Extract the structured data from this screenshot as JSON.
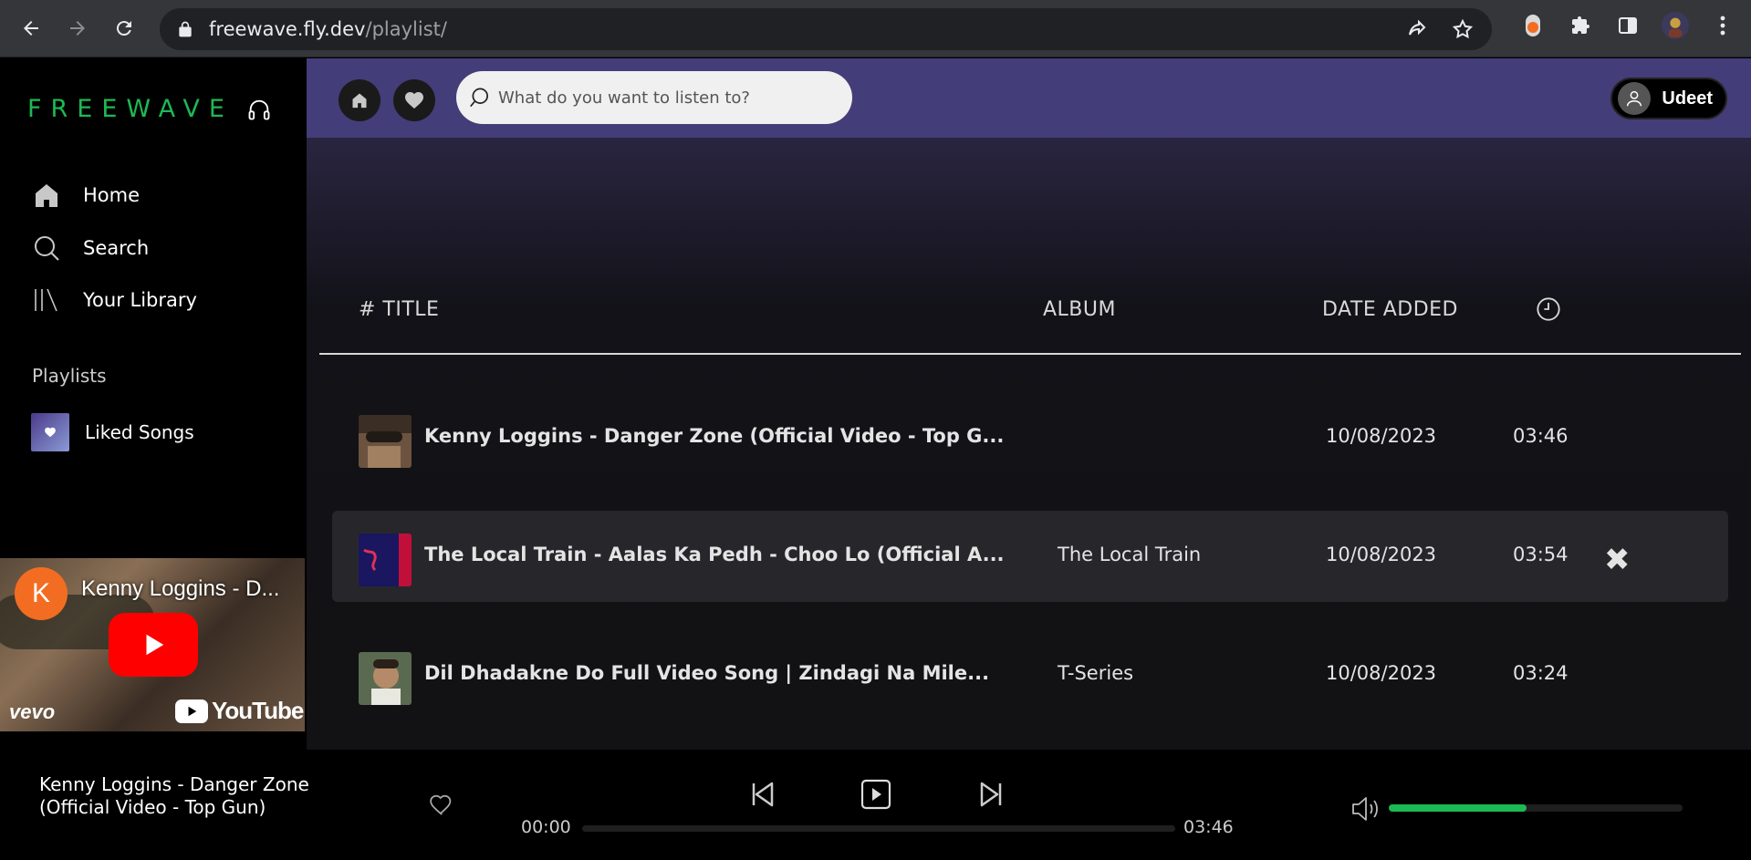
{
  "browser": {
    "url_host": "freewave.fly.dev",
    "url_path": "/playlist/"
  },
  "sidebar": {
    "logo": "FREEWAVE",
    "nav": [
      {
        "label": "Home",
        "icon": "home-icon"
      },
      {
        "label": "Search",
        "icon": "search-icon"
      },
      {
        "label": "Your Library",
        "icon": "library-icon"
      }
    ],
    "playlists_label": "Playlists",
    "liked_songs": "Liked Songs"
  },
  "video": {
    "channel_initial": "K",
    "title": "Kenny Loggins - D...",
    "vevo": "vevo",
    "youtube": "YouTube"
  },
  "header": {
    "search_placeholder": "What do you want to listen to?",
    "user_name": "Udeet"
  },
  "table": {
    "col_title": "# TITLE",
    "col_album": "ALBUM",
    "col_date": "DATE ADDED",
    "rows": [
      {
        "title": "Kenny Loggins - Danger Zone (Official Video - Top G...",
        "album": "",
        "date": "10/08/2023",
        "duration": "03:46"
      },
      {
        "title": "The Local Train - Aalas Ka Pedh - Choo Lo (Official A...",
        "album": "The Local Train",
        "date": "10/08/2023",
        "duration": "03:54"
      },
      {
        "title": "Dil Dhadakne Do Full Video Song | Zindagi Na Mile...",
        "album": "T-Series",
        "date": "10/08/2023",
        "duration": "03:24"
      }
    ],
    "remove_symbol": "✖"
  },
  "player": {
    "now_playing": "Kenny Loggins - Danger Zone (Official Video - Top Gun)",
    "current_time": "00:00",
    "total_time": "03:46",
    "progress": 0,
    "volume": 0.47
  },
  "colors": {
    "accent": "#1db954",
    "header_bg": "#433d79"
  }
}
